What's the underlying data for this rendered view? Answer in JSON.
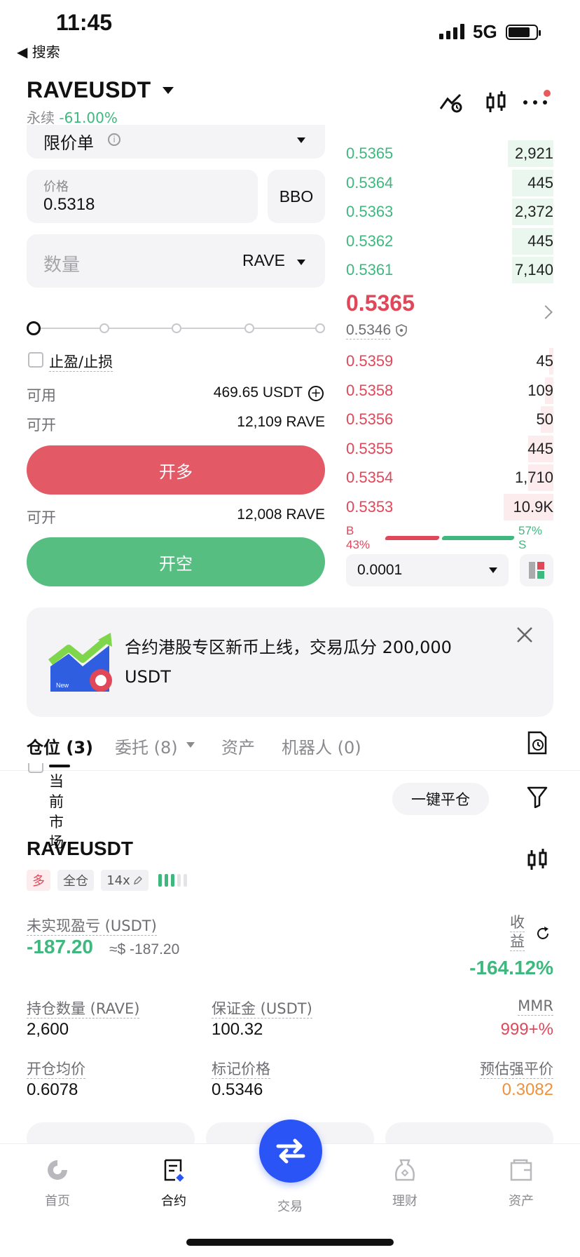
{
  "status_bar": {
    "time": "11:45",
    "back_app": "◀ 搜索",
    "network": "5G"
  },
  "header": {
    "symbol": "RAVEUSDT",
    "contract_type": "永续",
    "change": "-61.00%"
  },
  "order_form": {
    "order_type": "限价单",
    "price_label": "价格",
    "price_value": "0.5318",
    "bbo_label": "BBO",
    "quantity_placeholder": "数量",
    "quantity_unit": "RAVE",
    "tpsl_label": "止盈/止损",
    "available_label": "可用",
    "available_value": "469.65 USDT",
    "can_open_label": "可开",
    "can_open_long": "12,109 RAVE",
    "open_long_label": "开多",
    "can_open_short": "12,008 RAVE",
    "open_short_label": "开空"
  },
  "order_book": {
    "asks": [
      {
        "price": "0.5365",
        "qty": "2,921",
        "depth": 0.22
      },
      {
        "price": "0.5364",
        "qty": "445",
        "depth": 0.2
      },
      {
        "price": "0.5363",
        "qty": "2,372",
        "depth": 0.2
      },
      {
        "price": "0.5362",
        "qty": "445",
        "depth": 0.2
      },
      {
        "price": "0.5361",
        "qty": "7,140",
        "depth": 0.2
      }
    ],
    "last_price": "0.5365",
    "mark_price": "0.5346",
    "bids": [
      {
        "price": "0.5359",
        "qty": "45",
        "depth": 0.02
      },
      {
        "price": "0.5358",
        "qty": "109",
        "depth": 0.04
      },
      {
        "price": "0.5356",
        "qty": "50",
        "depth": 0.06
      },
      {
        "price": "0.5355",
        "qty": "445",
        "depth": 0.12
      },
      {
        "price": "0.5354",
        "qty": "1,710",
        "depth": 0.12
      },
      {
        "price": "0.5353",
        "qty": "10.9K",
        "depth": 0.24
      }
    ],
    "buy_ratio_label": "B 43%",
    "sell_ratio_label": "57% S",
    "buy_ratio": 0.43,
    "precision": "0.0001"
  },
  "banner": {
    "text": "合约港股专区新币上线，交易瓜分 200,000 USDT",
    "badge": "New"
  },
  "tabs": [
    {
      "label": "仓位 (3)"
    },
    {
      "label": "委托 (8)"
    },
    {
      "label": "资产"
    },
    {
      "label": "机器人 (0)"
    }
  ],
  "filter": {
    "current_market": "当前市场",
    "one_click_close": "一键平仓"
  },
  "position": {
    "symbol": "RAVEUSDT",
    "side": "多",
    "margin_mode": "全仓",
    "leverage": "14x",
    "unrealized_pnl_label": "未实现盈亏 (USDT)",
    "unrealized_pnl": "-187.20",
    "unrealized_pnl_approx": "≈$ -187.20",
    "roe_label": "收益",
    "roe": "-164.12%",
    "size_label": "持仓数量 (RAVE)",
    "size": "2,600",
    "margin_label": "保证金 (USDT)",
    "margin": "100.32",
    "mmr_label": "MMR",
    "mmr": "999+%",
    "entry_label": "开仓均价",
    "entry": "0.6078",
    "mark_label": "标记价格",
    "mark": "0.5346",
    "liq_label": "预估强平价",
    "liq": "0.3082"
  },
  "nav": [
    {
      "label": "首页"
    },
    {
      "label": "合约"
    },
    {
      "label": "交易"
    },
    {
      "label": "理财"
    },
    {
      "label": "资产"
    }
  ],
  "colors": {
    "green": "#3fb87f",
    "red": "#e0485a",
    "blue": "#2a54f5",
    "orange": "#f0913c"
  }
}
